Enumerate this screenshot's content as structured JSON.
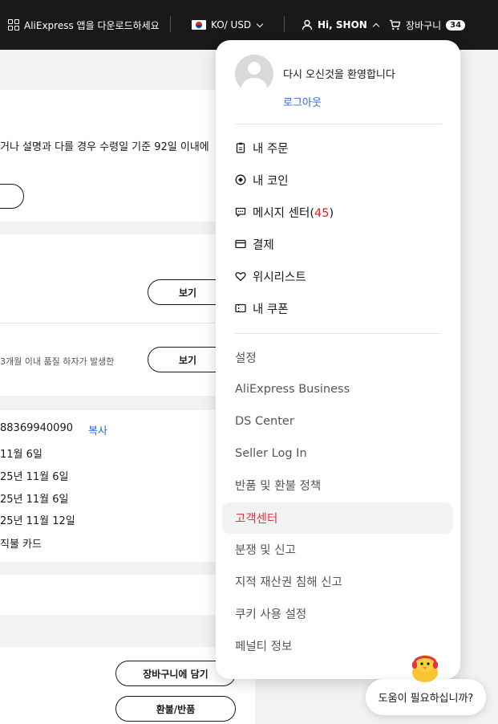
{
  "topbar": {
    "app_download": "AliExpress 앱을 다운로드하세요",
    "locale": "KO/ USD",
    "user_greeting": "Hi, SHON",
    "cart_label": "장바구니",
    "cart_count": "34"
  },
  "background": {
    "notice_text": "거나 설명과 다를 경우 수령일 기준 92일 이내에",
    "view_label": "보기",
    "quality_text": "3개월 이내 품질 하자가 발생한",
    "order_number": "88369940090",
    "copy_label": "복사",
    "dates": [
      "11월 6일",
      "25년 11월 6일",
      "25년 11월 6일",
      "25년 11월 12일"
    ],
    "payment_method": "직불 카드",
    "add_to_cart": "장바구니에 담기",
    "refund_return": "환불/반품"
  },
  "dropdown": {
    "welcome": "다시 오신것을 환영합니다",
    "logout": "로그아웃",
    "primary_items": [
      {
        "label": "내 주문",
        "icon": "clipboard-icon"
      },
      {
        "label": "내 코인",
        "icon": "coin-icon"
      },
      {
        "label": "메시지 센터",
        "icon": "message-icon",
        "count": "45"
      },
      {
        "label": "결제",
        "icon": "card-icon"
      },
      {
        "label": "위시리스트",
        "icon": "heart-icon"
      },
      {
        "label": "내 쿠폰",
        "icon": "coupon-icon"
      }
    ],
    "secondary_items": [
      "설정",
      "AliExpress Business",
      "DS Center",
      "Seller Log In",
      "반품 및 환불 정책",
      "고객센터",
      "분쟁 및 신고",
      "지적 재산권 침해 신고",
      "쿠키 사용 설정",
      "페널티 정보"
    ]
  },
  "help": {
    "label": "도움이 필요하십니까?"
  },
  "colors": {
    "topbar": "#191919",
    "link": "#2e6ad9",
    "active": "#e8323f",
    "count": "#e02020"
  }
}
